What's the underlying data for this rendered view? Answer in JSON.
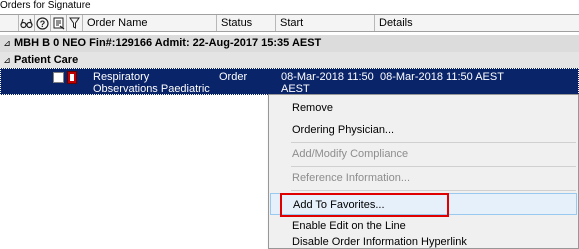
{
  "panel": {
    "title": "Orders for Signature"
  },
  "columns": {
    "icon1": "glasses-icon",
    "icon2": "help-icon",
    "icon3": "document-icon",
    "icon4": "filter-icon",
    "order_name": "Order Name",
    "status": "Status",
    "start": "Start",
    "details": "Details"
  },
  "patient_group": {
    "expand_glyph": "⊿",
    "label": "MBH B 0 NEO  Fin#:129166  Admit: 22-Aug-2017 15:35 AEST"
  },
  "care_group": {
    "expand_glyph": "⊿",
    "label": "Patient Care"
  },
  "order_row": {
    "name_line1": "Respiratory",
    "name_line2": "Observations Paediatric",
    "status": "Order",
    "start_line1": "08-Mar-2018 11:50",
    "start_line2": "AEST",
    "details": "08-Mar-2018 11:50 AEST",
    "selected": true
  },
  "context_menu": {
    "items": [
      {
        "label": "Remove",
        "enabled": true
      },
      {
        "label": "Ordering Physician...",
        "enabled": true
      },
      {
        "label": "Add/Modify Compliance",
        "enabled": false
      },
      {
        "label": "Reference Information...",
        "enabled": false
      },
      {
        "label": "Add To Favorites...",
        "enabled": true,
        "highlighted": true
      },
      {
        "label": "Enable Edit on the Line",
        "enabled": true
      },
      {
        "label": "Disable Order Information Hyperlink",
        "enabled": true
      }
    ]
  },
  "colors": {
    "selection": "#0a246a",
    "menu_background": "#f0f0f0",
    "highlight_border": "#e00000"
  }
}
